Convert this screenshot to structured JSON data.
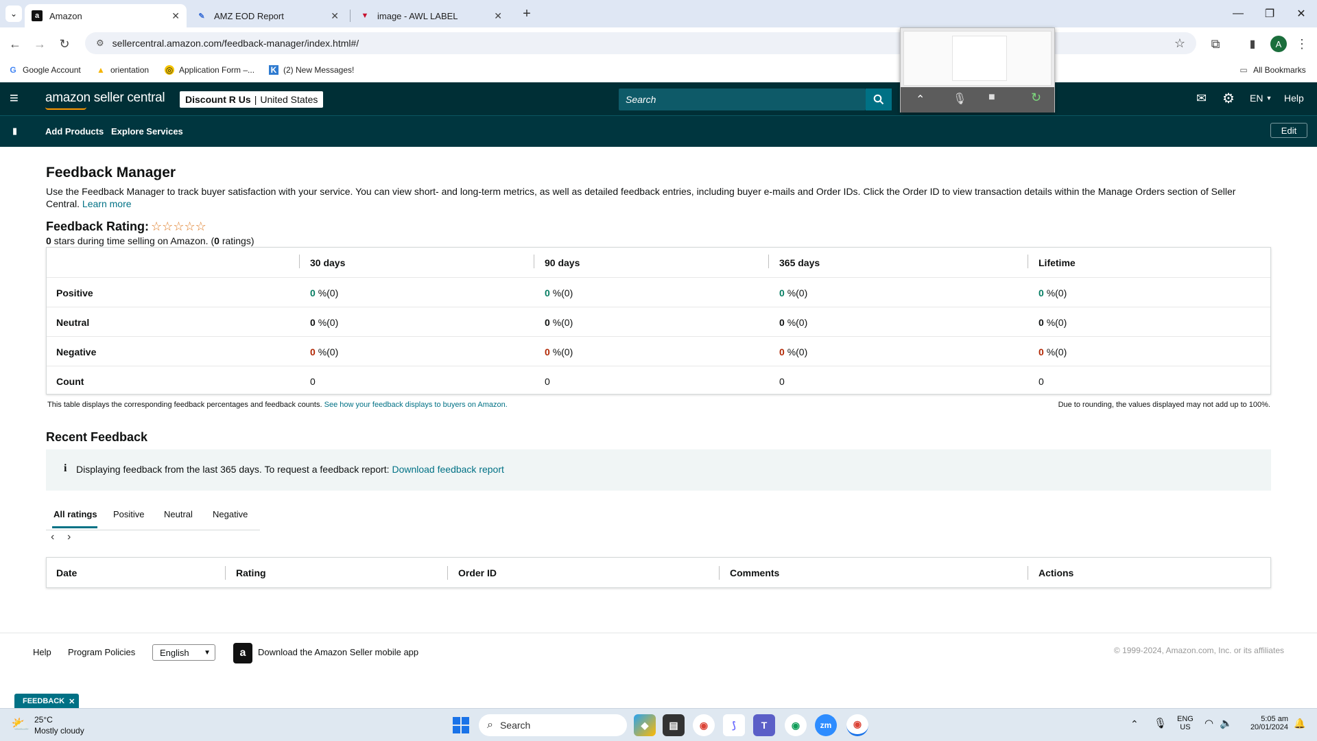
{
  "browser": {
    "tabs": [
      {
        "title": "Amazon",
        "icon": "amazon-a-icon",
        "active": true
      },
      {
        "title": "AMZ EOD Report",
        "icon": "pencil-icon",
        "active": false
      },
      {
        "title": "image - AWL LABEL",
        "icon": "v-logo-icon",
        "active": false
      }
    ],
    "url": "sellercentral.amazon.com/feedback-manager/index.html#/",
    "bookmarks": [
      {
        "label": "Google Account",
        "icon": "google-g-icon"
      },
      {
        "label": "orientation",
        "icon": "drive-icon"
      },
      {
        "label": "Application Form –...",
        "icon": "form-icon"
      },
      {
        "label": "(2) New Messages!",
        "icon": "k-icon"
      }
    ],
    "all_bookmarks": "All Bookmarks",
    "profile_initial": "A"
  },
  "header": {
    "logo": "amazon seller central",
    "store_name": "Discount R Us",
    "store_region": "United States",
    "search_placeholder": "Search",
    "language": "EN",
    "help": "Help"
  },
  "subnav": {
    "items": [
      "Add Products",
      "Explore Services"
    ],
    "edit": "Edit"
  },
  "page": {
    "title": "Feedback Manager",
    "intro": "Use the Feedback Manager to track buyer satisfaction with your service. You can view short- and long-term metrics, as well as detailed feedback entries, including buyer e-mails and Order IDs. Click the Order ID to view transaction details within the Manage Orders section of Seller Central.",
    "learn_more": "Learn more",
    "rating_label": "Feedback Rating:",
    "rating_stars": 0,
    "rating_summary": {
      "stars": "0",
      "text_a": " stars during time selling on Amazon. (",
      "count": "0",
      "text_b": " ratings)"
    },
    "stats": {
      "columns": [
        "30 days",
        "90 days",
        "365 days",
        "Lifetime"
      ],
      "rows": [
        {
          "label": "Positive",
          "values": [
            "0",
            "0",
            "0",
            "0"
          ],
          "suffix": "%(0)"
        },
        {
          "label": "Neutral",
          "values": [
            "0",
            "0",
            "0",
            "0"
          ],
          "suffix": "%(0)"
        },
        {
          "label": "Negative",
          "values": [
            "0",
            "0",
            "0",
            "0"
          ],
          "suffix": "%(0)"
        },
        {
          "label": "Count",
          "values": [
            "0",
            "0",
            "0",
            "0"
          ],
          "suffix": ""
        }
      ]
    },
    "table_note": "This table displays the corresponding feedback percentages and feedback counts.",
    "table_note_link": "See how your feedback displays to buyers on Amazon.",
    "rounding_note": "Due to rounding, the values displayed may not add up to 100%.",
    "recent_title": "Recent Feedback",
    "info_text": "Displaying feedback from the last 365 days. To request a feedback report:",
    "info_link": "Download feedback report",
    "filter_tabs": [
      "All ratings",
      "Positive",
      "Neutral",
      "Negative"
    ],
    "order_columns": [
      "Date",
      "Rating",
      "Order ID",
      "Comments",
      "Actions"
    ]
  },
  "footer": {
    "help": "Help",
    "policies": "Program Policies",
    "language": "English",
    "app_text": "Download the Amazon Seller mobile app",
    "copyright": "© 1999-2024, Amazon.com, Inc. or its affiliates",
    "feedback_tab": "FEEDBACK"
  },
  "taskbar": {
    "temp": "25°C",
    "weather": "Mostly cloudy",
    "search": "Search",
    "lang1": "ENG",
    "lang2": "US",
    "time": "5:05 am",
    "date": "20/01/2024"
  },
  "colors": {
    "header_bg": "#002f36",
    "subnav_bg": "#00363f",
    "accent": "#007185",
    "positive": "#067d62",
    "negative": "#b12704"
  }
}
